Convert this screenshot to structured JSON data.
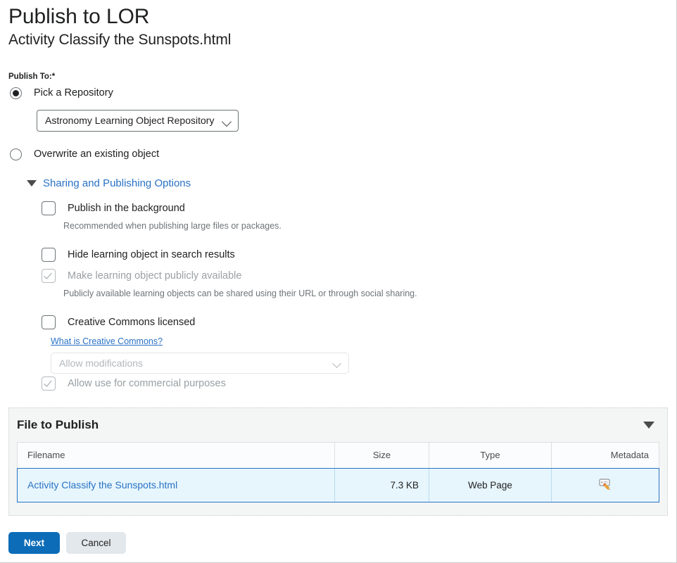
{
  "header": {
    "title": "Publish to LOR",
    "subtitle": "Activity Classify the Sunspots.html"
  },
  "form": {
    "publish_to_label": "Publish To:",
    "required_marker": "*",
    "radios": [
      {
        "label": "Pick a Repository",
        "selected": true
      },
      {
        "label": "Overwrite an existing object",
        "selected": false
      }
    ],
    "repository_select": {
      "value": "Astronomy Learning Object Repository",
      "icon": "chevron-down-icon"
    },
    "disclosure": {
      "label": "Sharing and Publishing Options",
      "icon": "triangle-down-icon",
      "expanded": true
    },
    "options": [
      {
        "label": "Publish in the background",
        "checked": false,
        "disabled": false,
        "help": "Recommended when publishing large files or packages."
      },
      {
        "label": "Hide learning object in search results",
        "checked": false,
        "disabled": false,
        "help": ""
      },
      {
        "label": "Make learning object publicly available",
        "checked": true,
        "disabled": true,
        "help": "Publicly available learning objects can be shared using their URL or through social sharing."
      },
      {
        "label": "Creative Commons licensed",
        "checked": false,
        "disabled": false,
        "help": ""
      }
    ],
    "cc_link": "What is Creative Commons?",
    "cc_select": {
      "value": "Allow modifications",
      "disabled": true,
      "icon": "chevron-down-icon"
    },
    "cc_commercial": {
      "label": "Allow use for commercial purposes",
      "checked": true,
      "disabled": true
    }
  },
  "panel": {
    "title": "File to Publish",
    "collapse_icon": "triangle-down-icon",
    "table": {
      "columns": [
        "Filename",
        "Size",
        "Type",
        "Metadata"
      ],
      "rows": [
        {
          "filename": "Activity Classify the Sunspots.html",
          "size": "7.3 KB",
          "type": "Web Page",
          "metadata_icon": "metadata-edit-icon"
        }
      ]
    }
  },
  "footer": {
    "next_label": "Next",
    "cancel_label": "Cancel"
  },
  "colors": {
    "link": "#2a72c4",
    "primary_button": "#0c6cb8",
    "secondary_button": "#e3e8ec",
    "row_highlight": "#e7f6fd",
    "panel_background": "#f4f5f5",
    "text": "#202122",
    "muted_text": "#6e7477",
    "disabled_text": "#9aa0a4"
  }
}
